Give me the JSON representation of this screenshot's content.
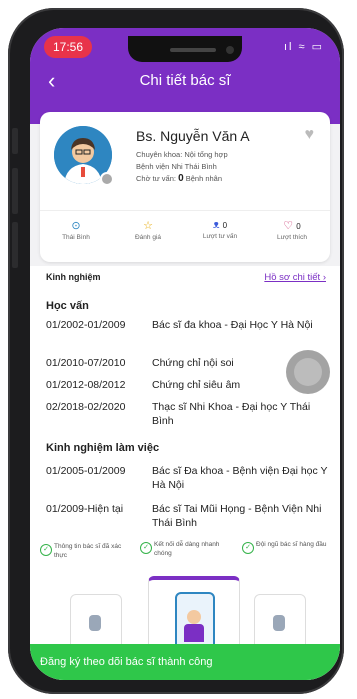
{
  "status_bar": {
    "time": "17:56",
    "icons_text": "ıl ≈ ▭"
  },
  "header": {
    "back_icon": "‹",
    "title": "Chi tiết bác sĩ"
  },
  "doctor": {
    "name": "Bs. Nguyễn Văn A",
    "specialty": "Chuyên khoa: Nội tổng hợp",
    "hospital": "Bệnh viện Nhi Thái Bình",
    "consult_label": "Chờ tư vấn:",
    "consult_count": "0",
    "consult_suffix": "Bệnh nhân"
  },
  "stats": [
    {
      "icon": "location-icon",
      "glyph": "⊙",
      "value": "",
      "label": "Thái Bình"
    },
    {
      "icon": "star-icon",
      "glyph": "☆",
      "value": "",
      "label": "Đánh giá"
    },
    {
      "icon": "people-icon",
      "glyph": "ᴥ",
      "value": "0",
      "label": "Lượt tư vấn"
    },
    {
      "icon": "heart-outline-icon",
      "glyph": "♡",
      "value": "0",
      "label": "Lượt thích"
    }
  ],
  "experience": {
    "heading": "Kinh nghiệm",
    "link": "Hồ sơ chi tiết ›"
  },
  "education": {
    "title": "Học vấn",
    "items": [
      {
        "date": "01/2002-01/2009",
        "desc": "Bác sĩ đa khoa - Đại Học Y Hà Nội"
      },
      {
        "date": "01/2010-07/2010",
        "desc": "Chứng chỉ nội soi"
      },
      {
        "date": "01/2012-08/2012",
        "desc": "Chứng chỉ siêu âm"
      },
      {
        "date": "02/2018-02/2020",
        "desc": "Thạc sĩ Nhi Khoa - Đại học Y Thái Bình"
      }
    ]
  },
  "work": {
    "title": "Kinh nghiệm làm việc",
    "items": [
      {
        "date": "01/2005-01/2009",
        "desc": "Bác sĩ Đa khoa - Bệnh viện Đại học Y Hà Nội"
      },
      {
        "date": "01/2009-Hiện tại",
        "desc": "Bác sĩ Tai Mũi Họng - Bệnh Viện Nhi Thái Bình"
      }
    ]
  },
  "features": [
    "Thông tin bác sĩ đã xác thực",
    "Kết nối dễ dàng nhanh chóng",
    "Đội ngũ bác sĩ hàng đầu"
  ],
  "toast": "Đăng ký theo dõi bác sĩ thành công",
  "colors": {
    "primary": "#7b2fc4",
    "toast": "#2fc74a",
    "time_pill": "#e8334a"
  }
}
